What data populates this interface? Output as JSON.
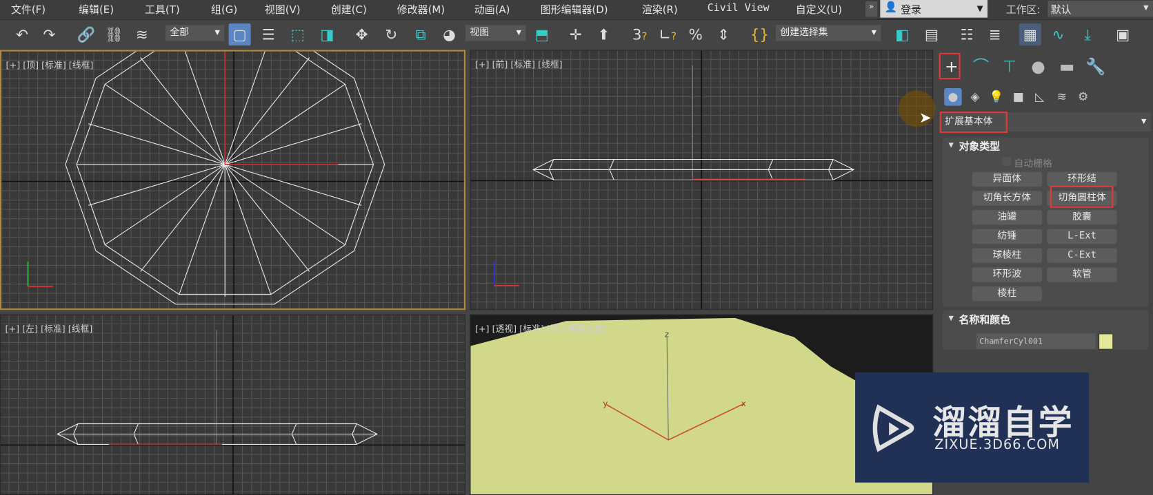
{
  "menu": [
    "文件(F)",
    "编辑(E)",
    "工具(T)",
    "组(G)",
    "视图(V)",
    "创建(C)",
    "修改器(M)",
    "动画(A)",
    "图形编辑器(D)",
    "渲染(R)",
    "Civil View",
    "自定义(U)"
  ],
  "login": {
    "label": "登录",
    "icon": "user-icon"
  },
  "workspace": {
    "label": "工作区:",
    "value": "默认"
  },
  "toolbar": {
    "selection_filter": "全部",
    "reference_coord": "视图",
    "named_selection": "创建选择集"
  },
  "viewports": {
    "top": "[+] [顶] [标准] [线框]",
    "front": "[+] [前] [标准] [线框]",
    "left": "[+] [左] [标准] [线框]",
    "perspective": "[+] [透视] [标准] [默认明暗处理]"
  },
  "axes": {
    "x": "x",
    "y": "y",
    "z": "z"
  },
  "panel": {
    "category": "扩展基本体",
    "object_type": {
      "title": "对象类型",
      "autogrid": "自动栅格",
      "buttons": [
        "异面体",
        "环形结",
        "切角长方体",
        "切角圆柱体",
        "油罐",
        "胶囊",
        "纺锤",
        "L-Ext",
        "球棱柱",
        "C-Ext",
        "环形波",
        "软管",
        "棱柱"
      ]
    },
    "name_color": {
      "title": "名称和颜色",
      "name": "ChamferCyl001",
      "color": "#e3e89a"
    }
  },
  "colors": {
    "highlight": "#e23a3a",
    "object": "#d2d88a",
    "active_border": "#b08a3a"
  },
  "watermark": {
    "cn": "溜溜自学",
    "url": "ZIXUE.3D66.COM"
  }
}
